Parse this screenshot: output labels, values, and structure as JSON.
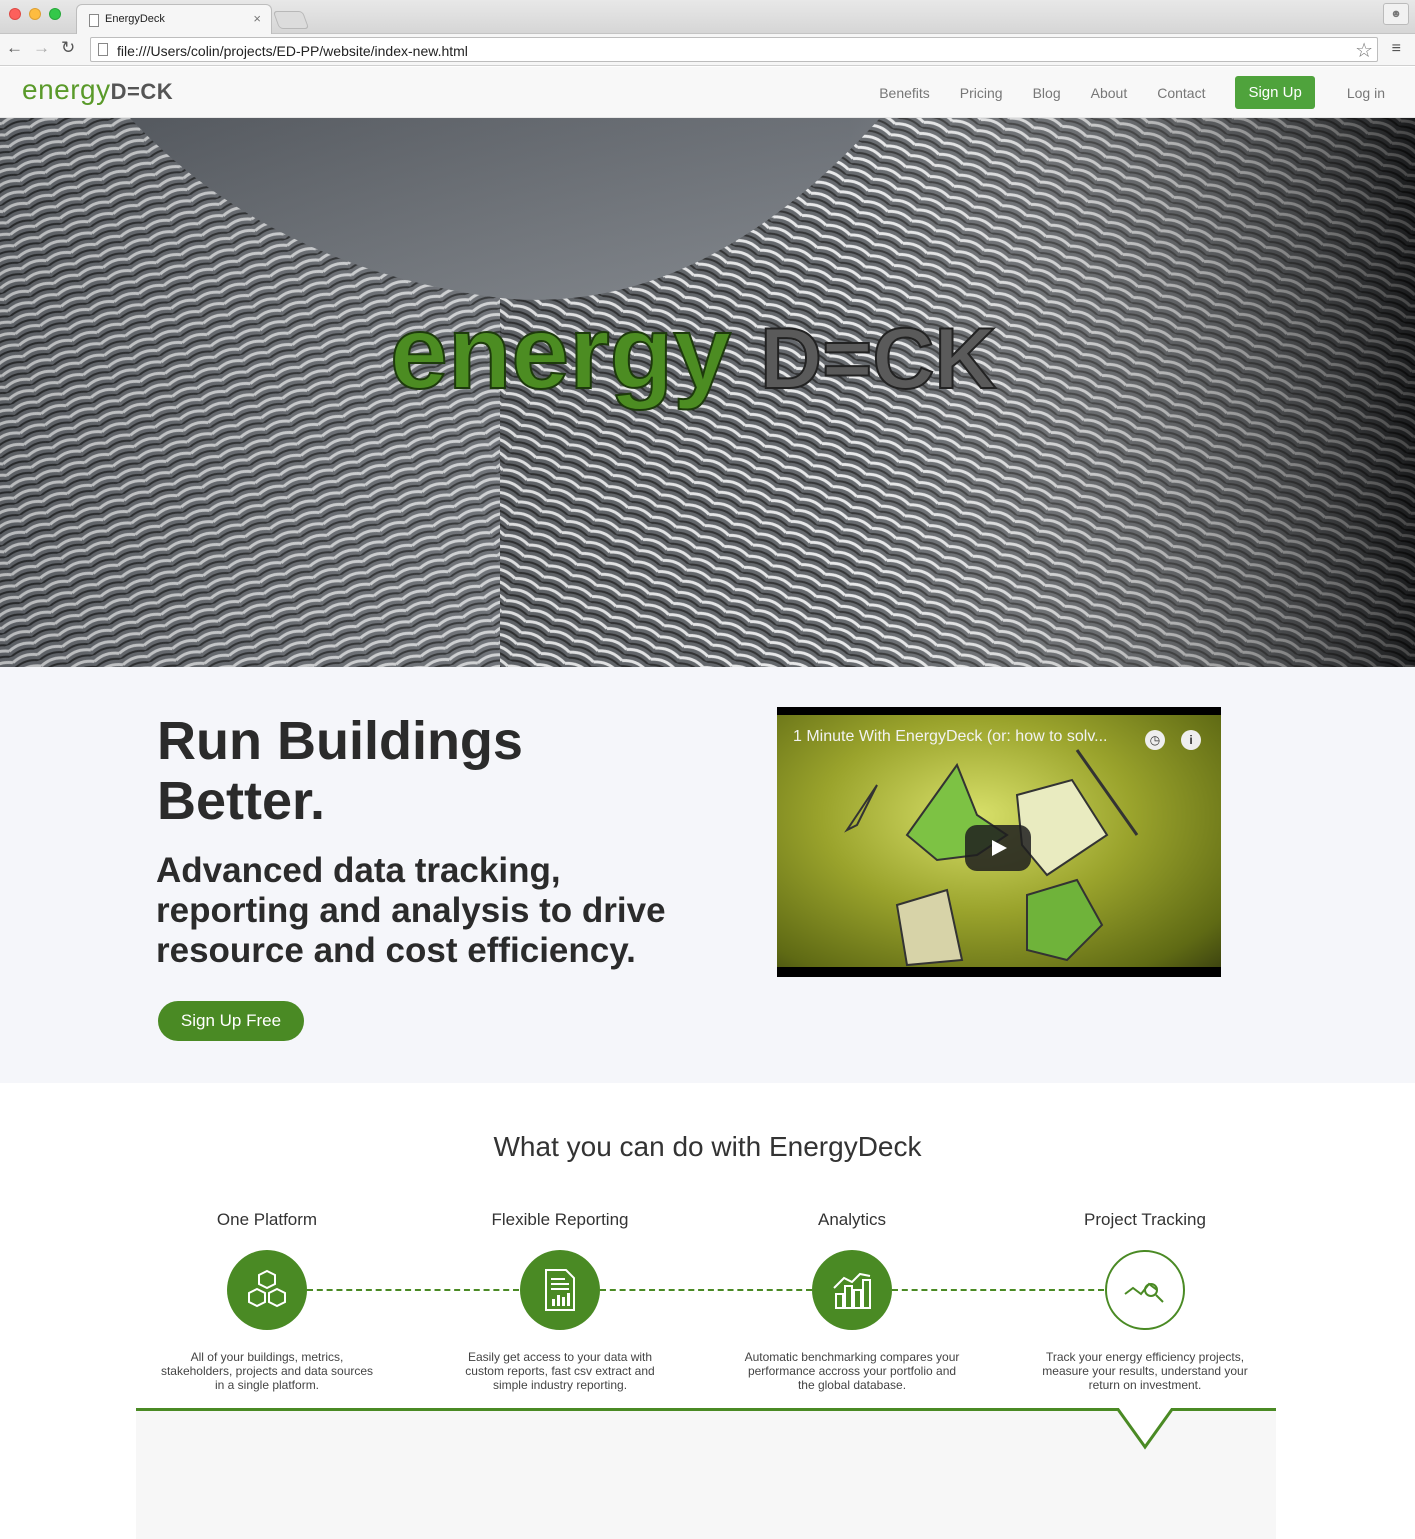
{
  "browser": {
    "tab_title": "EnergyDeck",
    "tab_close": "×",
    "url": "file:///Users/colin/projects/ED-PP/website/index-new.html"
  },
  "nav": {
    "logo_energy": "energy",
    "logo_deck": "D=CK",
    "links": [
      "Benefits",
      "Pricing",
      "Blog",
      "About",
      "Contact"
    ],
    "signup": "Sign Up",
    "login": "Log in"
  },
  "hero": {
    "logo_energy": "energy",
    "logo_deck": "D=CK"
  },
  "intro": {
    "headline": "Run Buildings Better.",
    "subheadline": "Advanced data tracking, reporting and analysis to drive resource and cost efficiency.",
    "cta": "Sign Up Free",
    "video_title": "1 Minute With EnergyDeck (or: how to solv..."
  },
  "features": {
    "title": "What you can do with EnergyDeck",
    "items": [
      {
        "title": "One Platform",
        "desc": "All of your buildings, metrics, stakeholders, projects and data sources in a single platform.",
        "icon": "cubes-icon"
      },
      {
        "title": "Flexible Reporting",
        "desc": "Easily get access to your data with custom reports, fast csv extract and simple industry reporting.",
        "icon": "report-icon"
      },
      {
        "title": "Analytics",
        "desc": "Automatic benchmarking compares your performance accross your portfolio and the global database.",
        "icon": "chart-icon"
      },
      {
        "title": "Project Tracking",
        "desc": "Track your energy efficiency projects, measure your results, understand your return on investment.",
        "icon": "tracking-icon"
      }
    ]
  },
  "colors": {
    "brand_green": "#4a8a24",
    "nav_button_green": "#4fa33c",
    "intro_bg": "#f5f6fa"
  }
}
